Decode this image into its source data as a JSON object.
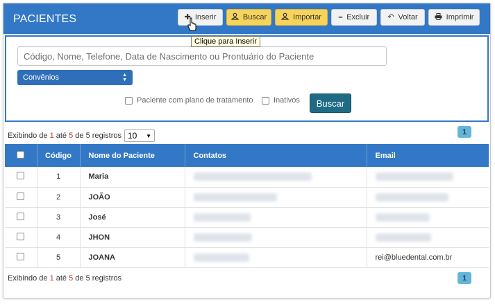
{
  "header": {
    "title": "PACIENTES"
  },
  "toolbar": [
    {
      "key": "inserir",
      "label": "Inserir",
      "icon": "plus-icon",
      "glyph": "✚",
      "style": "white"
    },
    {
      "key": "buscar",
      "label": "Buscar",
      "icon": "user-search-icon",
      "glyph": "👤",
      "style": "yellow"
    },
    {
      "key": "importar",
      "label": "Importar",
      "icon": "user-import-icon",
      "glyph": "👤",
      "style": "yellow"
    },
    {
      "key": "excluir",
      "label": "Excluir",
      "icon": "minus-icon",
      "glyph": "━",
      "style": "white"
    },
    {
      "key": "voltar",
      "label": "Voltar",
      "icon": "undo-icon",
      "glyph": "↶",
      "style": "white"
    },
    {
      "key": "imprimir",
      "label": "Imprimir",
      "icon": "print-icon",
      "glyph": "🖶",
      "style": "white"
    }
  ],
  "tooltip": "Clique para Inserir",
  "search": {
    "placeholder": "Código, Nome, Telefone, Data de Nascimento ou Prontuário do Paciente",
    "convenios_label": "Convênios",
    "opt_plano": "Paciente com plano de tratamento",
    "opt_inativos": "Inativos",
    "button": "Buscar"
  },
  "info": {
    "prefix": "Exibindo de",
    "from": "1",
    "ate": "até",
    "to": "5",
    "de": "de",
    "total": "5",
    "suffix": "registros",
    "per_page": "10",
    "page": "1"
  },
  "table": {
    "headers": {
      "codigo": "Código",
      "nome": "Nome do Paciente",
      "contatos": "Contatos",
      "email": "Email"
    },
    "rows": [
      {
        "codigo": "1",
        "nome": "Maria",
        "email": ""
      },
      {
        "codigo": "2",
        "nome": "JOÃO",
        "email": ""
      },
      {
        "codigo": "3",
        "nome": "José",
        "email": ""
      },
      {
        "codigo": "4",
        "nome": "JHON",
        "email": ""
      },
      {
        "codigo": "5",
        "nome": "JOANA",
        "email": "rei@bluedental.com.br"
      }
    ]
  }
}
